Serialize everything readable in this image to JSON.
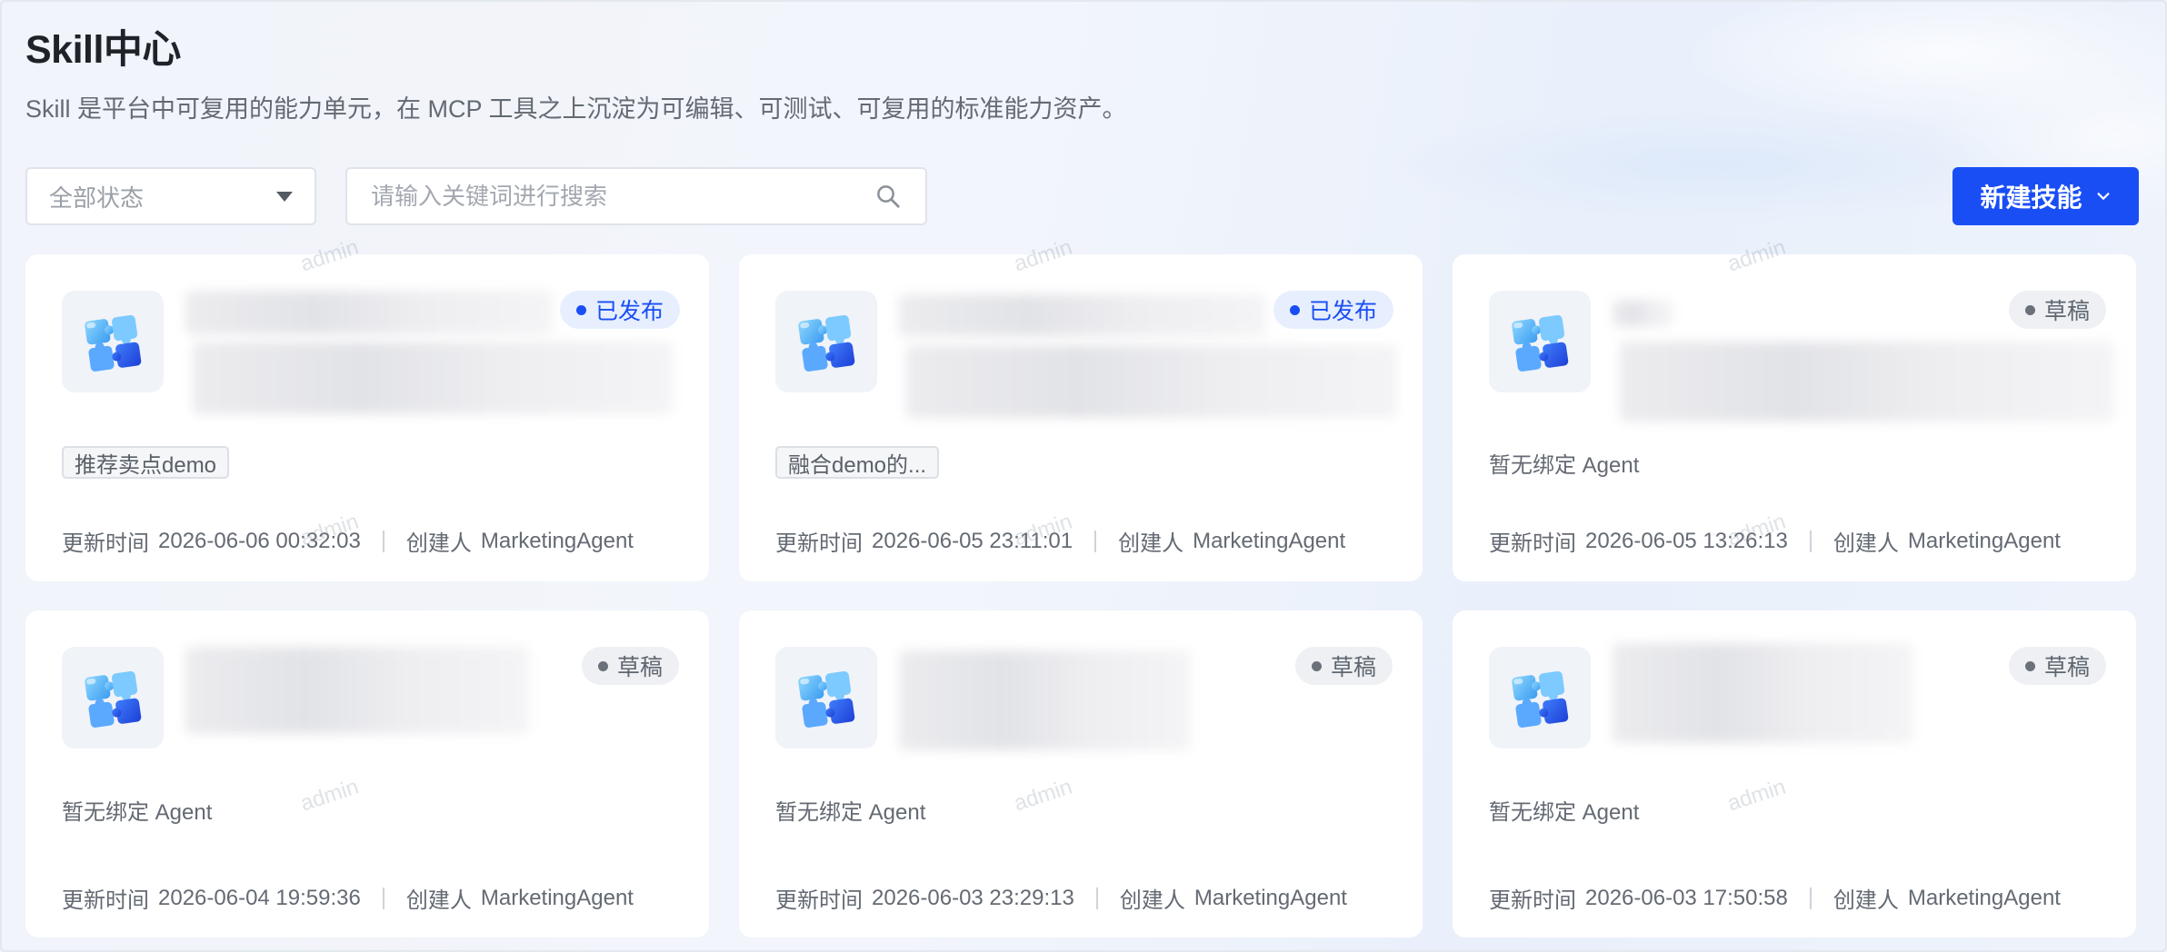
{
  "header": {
    "title": "Skill中心",
    "subtitle": "Skill 是平台中可复用的能力单元，在 MCP 工具之上沉淀为可编辑、可测试、可复用的标准能力资产。"
  },
  "filters": {
    "status_selected": "全部状态",
    "search_placeholder": "请输入关键词进行搜索"
  },
  "toolbar": {
    "new_skill_label": "新建技能"
  },
  "watermark_text": "admin",
  "cards": [
    {
      "status": "已发布",
      "status_type": "published",
      "agent": "推荐卖点demo",
      "updated_label": "更新时间",
      "updated_at": "2026-06-06 00:32:03",
      "creator_label": "创建人",
      "creator": "MarketingAgent"
    },
    {
      "status": "已发布",
      "status_type": "published",
      "agent": "融合demo的...",
      "updated_label": "更新时间",
      "updated_at": "2026-06-05 23:11:01",
      "creator_label": "创建人",
      "creator": "MarketingAgent"
    },
    {
      "status": "草稿",
      "status_type": "draft",
      "agent": "暂无绑定 Agent",
      "updated_label": "更新时间",
      "updated_at": "2026-06-05 13:26:13",
      "creator_label": "创建人",
      "creator": "MarketingAgent"
    },
    {
      "status": "草稿",
      "status_type": "draft",
      "agent": "暂无绑定 Agent",
      "updated_label": "更新时间",
      "updated_at": "2026-06-04 19:59:36",
      "creator_label": "创建人",
      "creator": "MarketingAgent"
    },
    {
      "status": "草稿",
      "status_type": "draft",
      "agent": "暂无绑定 Agent",
      "updated_label": "更新时间",
      "updated_at": "2026-06-03 23:29:13",
      "creator_label": "创建人",
      "creator": "MarketingAgent"
    },
    {
      "status": "草稿",
      "status_type": "draft",
      "agent": "暂无绑定 Agent",
      "updated_label": "更新时间",
      "updated_at": "2026-06-03 17:50:58",
      "creator_label": "创建人",
      "creator": "MarketingAgent"
    }
  ],
  "colors": {
    "primary": "#1a4ef5",
    "published_bg": "#e7efff",
    "draft_bg": "#eef0f3"
  },
  "icons": {
    "status_dropdown": "caret-down-icon",
    "search": "search-icon",
    "new_button": "chevron-down-icon",
    "skill_logo": "puzzle-icon"
  }
}
